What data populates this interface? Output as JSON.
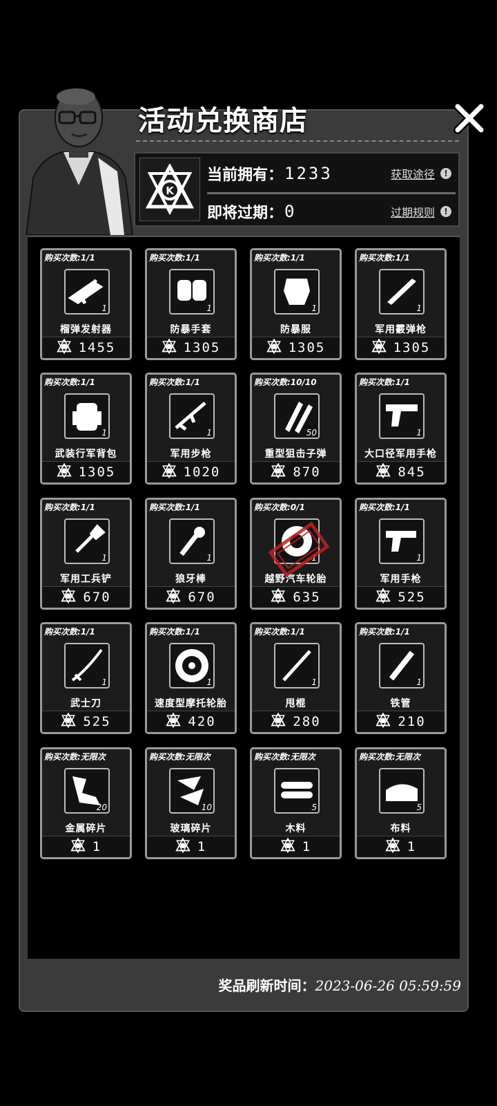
{
  "header": {
    "title": "活动兑换商店",
    "close_icon": "close-icon"
  },
  "currency": {
    "owned_label": "当前拥有：",
    "owned_value": "1233",
    "expiring_label": "即将过期：",
    "expiring_value": "0",
    "get_link": "获取途径",
    "expire_rule_link": "过期规则",
    "info_mark": "!",
    "emblem_letter": "K"
  },
  "items": [
    {
      "limit": "购买次数:1/1",
      "name": "榴弹发射器",
      "qty": "1",
      "price": "1455",
      "icon": "grenade-launcher-icon",
      "sold_out": false
    },
    {
      "limit": "购买次数:1/1",
      "name": "防暴手套",
      "qty": "1",
      "price": "1305",
      "icon": "riot-gloves-icon",
      "sold_out": false
    },
    {
      "limit": "购买次数:1/1",
      "name": "防暴服",
      "qty": "1",
      "price": "1305",
      "icon": "riot-suit-icon",
      "sold_out": false
    },
    {
      "limit": "购买次数:1/1",
      "name": "军用霰弹枪",
      "qty": "1",
      "price": "1305",
      "icon": "shotgun-icon",
      "sold_out": false
    },
    {
      "limit": "购买次数:1/1",
      "name": "武装行军背包",
      "qty": "1",
      "price": "1305",
      "icon": "backpack-icon",
      "sold_out": false
    },
    {
      "limit": "购买次数:1/1",
      "name": "军用步枪",
      "qty": "1",
      "price": "1020",
      "icon": "rifle-icon",
      "sold_out": false
    },
    {
      "limit": "购买次数:10/10",
      "name": "重型狙击子弹",
      "qty": "50",
      "price": "870",
      "icon": "sniper-ammo-icon",
      "sold_out": false
    },
    {
      "limit": "购买次数:1/1",
      "name": "大口径军用手枪",
      "qty": "1",
      "price": "845",
      "icon": "large-pistol-icon",
      "sold_out": false
    },
    {
      "limit": "购买次数:1/1",
      "name": "军用工兵铲",
      "qty": "1",
      "price": "670",
      "icon": "shovel-icon",
      "sold_out": false
    },
    {
      "limit": "购买次数:1/1",
      "name": "狼牙棒",
      "qty": "1",
      "price": "670",
      "icon": "spiked-club-icon",
      "sold_out": false
    },
    {
      "limit": "购买次数:0/1",
      "name": "越野汽车轮胎",
      "qty": "1",
      "price": "635",
      "icon": "offroad-tire-icon",
      "sold_out": true
    },
    {
      "limit": "购买次数:1/1",
      "name": "军用手枪",
      "qty": "1",
      "price": "525",
      "icon": "pistol-icon",
      "sold_out": false
    },
    {
      "limit": "购买次数:1/1",
      "name": "武士刀",
      "qty": "1",
      "price": "525",
      "icon": "katana-icon",
      "sold_out": false
    },
    {
      "limit": "购买次数:1/1",
      "name": "速度型摩托轮胎",
      "qty": "1",
      "price": "420",
      "icon": "moto-tire-icon",
      "sold_out": false
    },
    {
      "limit": "购买次数:1/1",
      "name": "甩棍",
      "qty": "1",
      "price": "280",
      "icon": "baton-icon",
      "sold_out": false
    },
    {
      "limit": "购买次数:1/1",
      "name": "铁管",
      "qty": "1",
      "price": "210",
      "icon": "iron-pipe-icon",
      "sold_out": false
    },
    {
      "limit": "购买次数:无限次",
      "name": "金属碎片",
      "qty": "20",
      "price": "1",
      "icon": "metal-scrap-icon",
      "sold_out": false
    },
    {
      "limit": "购买次数:无限次",
      "name": "玻璃碎片",
      "qty": "10",
      "price": "1",
      "icon": "glass-shard-icon",
      "sold_out": false
    },
    {
      "limit": "购买次数:无限次",
      "name": "木料",
      "qty": "5",
      "price": "1",
      "icon": "wood-icon",
      "sold_out": false
    },
    {
      "limit": "购买次数:无限次",
      "name": "布料",
      "qty": "5",
      "price": "1",
      "icon": "cloth-icon",
      "sold_out": false
    }
  ],
  "footer": {
    "refresh_label": "奖品刷新时间：",
    "refresh_time": "2023-06-26  05:59:59"
  }
}
